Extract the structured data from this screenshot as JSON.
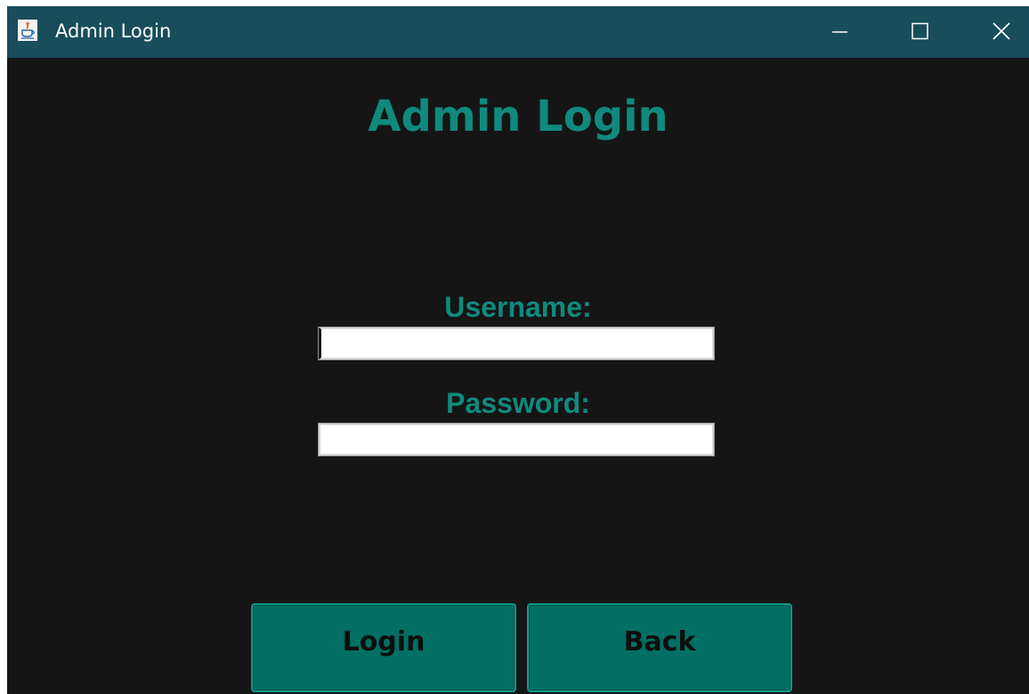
{
  "window": {
    "title": "Admin Login",
    "controls": {
      "minimize_icon": "minimize-icon",
      "maximize_icon": "maximize-icon",
      "close_icon": "close-icon"
    },
    "app_icon": "java-icon"
  },
  "form": {
    "heading": "Admin Login",
    "username_label": "Username:",
    "username_value": "",
    "password_label": "Password:",
    "password_value": ""
  },
  "actions": {
    "login_label": "Login",
    "back_label": "Back"
  },
  "colors": {
    "titlebar": "#184d5c",
    "background": "#151515",
    "accent_text": "#0f8a7d",
    "button_fill": "#026f64"
  }
}
